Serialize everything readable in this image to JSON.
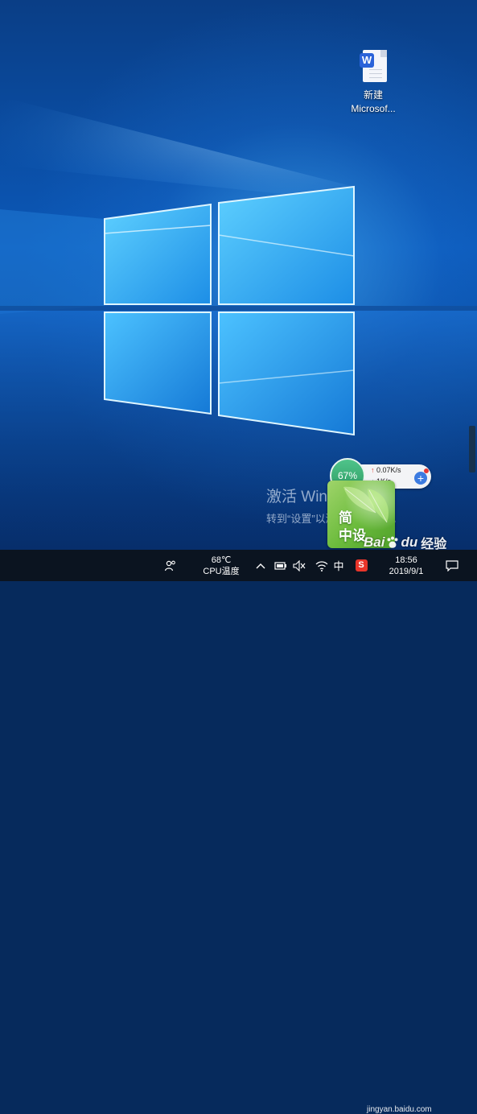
{
  "desktop": {
    "icons": [
      {
        "label_line1": "新建",
        "label_line2": "Microsof...",
        "badge": "W"
      }
    ]
  },
  "activation": {
    "title": "激活 Windows",
    "subtitle": "转到“设置”以激活 Windows。"
  },
  "speed_widget": {
    "usage": "67%",
    "upload": "0.07K/s",
    "download": "1K/s",
    "boost_symbol": "+"
  },
  "leaf_widget": {
    "line1": "简",
    "line2": "中设"
  },
  "taskbar": {
    "cpu_temp": "68℃",
    "cpu_label": "CPU温度",
    "ime_label": "中",
    "sogou_label": "S",
    "time": "18:56",
    "date": "2019/9/1",
    "icons": [
      "people-icon",
      "chevron-up-icon",
      "battery-icon",
      "volume-muted-icon",
      "wifi-icon",
      "notification-icon"
    ]
  },
  "watermark": {
    "bai": "Bai",
    "du": "du",
    "jingyan": "经验",
    "url": "jingyan.baidu.com"
  },
  "colors": {
    "wallpaper_light": "#5cc8ff",
    "wallpaper_dark": "#0a3e86",
    "taskbar": "#0b1420",
    "speed_green": "#2e9c64",
    "boost_blue": "#3c7be0"
  }
}
